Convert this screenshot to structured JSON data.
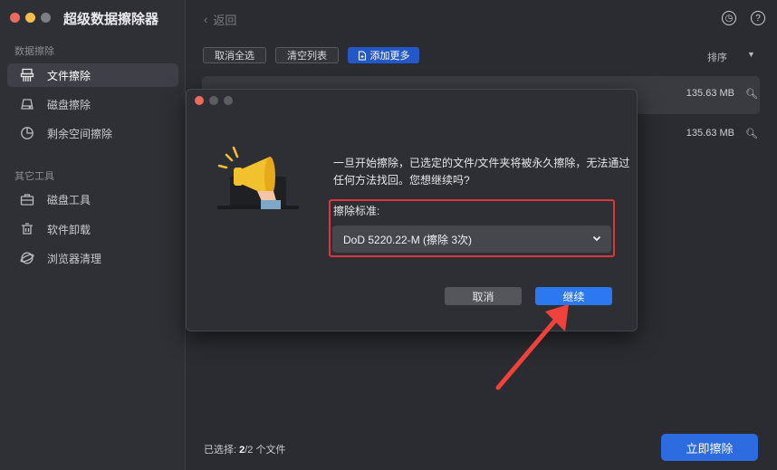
{
  "app": {
    "title": "超级数据擦除器"
  },
  "colors": {
    "traffic_close": "#ed6a5e",
    "traffic_min": "#f4bf4f",
    "traffic_max": "#61c554",
    "accent": "#2c78f0",
    "highlight_border": "#e0343f",
    "annotation_arrow": "#f0423c"
  },
  "sidebar": {
    "section1": "数据擦除",
    "items1": [
      {
        "label": "文件擦除",
        "icon": "shredder-icon",
        "active": true
      },
      {
        "label": "磁盘擦除",
        "icon": "disk-icon"
      },
      {
        "label": "剩余空间擦除",
        "icon": "pie-chart-icon"
      }
    ],
    "section2": "其它工具",
    "items2": [
      {
        "label": "磁盘工具",
        "icon": "toolbox-icon"
      },
      {
        "label": "软件卸载",
        "icon": "uninstall-icon"
      },
      {
        "label": "浏览器清理",
        "icon": "browser-icon"
      }
    ]
  },
  "header": {
    "back_label": "返回",
    "history_icon": "history-icon",
    "help_icon": "help-icon"
  },
  "toolbar": {
    "deselect_all": "取消全选",
    "clear_list": "清空列表",
    "add_more": "添加更多",
    "sort_label": "排序"
  },
  "files": [
    {
      "size": "135.63 MB"
    },
    {
      "size": "135.63 MB"
    }
  ],
  "footer": {
    "selected_prefix": "已选择: ",
    "selected_count": "2",
    "selected_suffix": "/2 个文件",
    "erase_now": "立即擦除"
  },
  "dialog": {
    "message": "一旦开始擦除，已选定的文件/文件夹将被永久擦除，无法通过任何方法找回。您想继续吗?",
    "standard_label": "擦除标准:",
    "standard_value": "DoD 5220.22-M (擦除 3次)",
    "cancel": "取消",
    "continue": "继续"
  }
}
